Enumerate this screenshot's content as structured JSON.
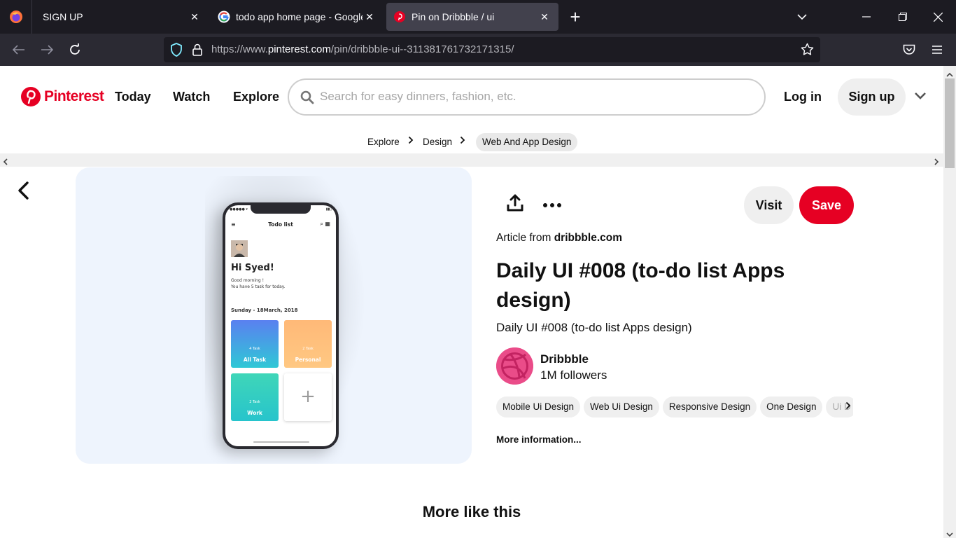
{
  "browser": {
    "tabs": [
      {
        "title": "SIGN UP",
        "close": "✕"
      },
      {
        "title": "todo app home page - Google",
        "close": "✕"
      },
      {
        "title": "Pin on Dribbble / ui",
        "close": "✕"
      }
    ],
    "new_tab": "+",
    "url_prefix": "https://www.",
    "url_domain": "pinterest.com",
    "url_path": "/pin/dribbble-ui--311381761732171315/"
  },
  "header": {
    "logo_text": "Pinterest",
    "nav": [
      "Today",
      "Watch",
      "Explore"
    ],
    "search_placeholder": "Search for easy dinners, fashion, etc.",
    "login": "Log in",
    "signup": "Sign up"
  },
  "breadcrumbs": [
    "Explore",
    "Design",
    "Web And App Design"
  ],
  "pin_image": {
    "app_title": "Todo list",
    "greeting": "Hi Syed!",
    "sub_line1": "Good morning !",
    "sub_line2": "You have 5 task for today.",
    "date": "Sunday - 18March, 2018",
    "cards": [
      {
        "count": "4 Task",
        "name": "All Task"
      },
      {
        "count": "2 Task",
        "name": "Personal"
      },
      {
        "count": "2 Task",
        "name": "Work"
      }
    ],
    "add_symbol": "+"
  },
  "pin": {
    "visit": "Visit",
    "save": "Save",
    "article_from_prefix": "Article from ",
    "article_source": "dribbble.com",
    "title": "Daily UI #008 (to-do list Apps design)",
    "description": "Daily UI #008 (to-do list Apps design)",
    "creator_name": "Dribbble",
    "creator_followers": "1M followers",
    "tags": [
      "Mobile Ui Design",
      "Web Ui Design",
      "Responsive Design",
      "One Design",
      "Ui D"
    ],
    "more_info": "More information..."
  },
  "more_like_this": "More like this",
  "colors": {
    "brand": "#e60023",
    "dribbble": "#ea4c89"
  }
}
